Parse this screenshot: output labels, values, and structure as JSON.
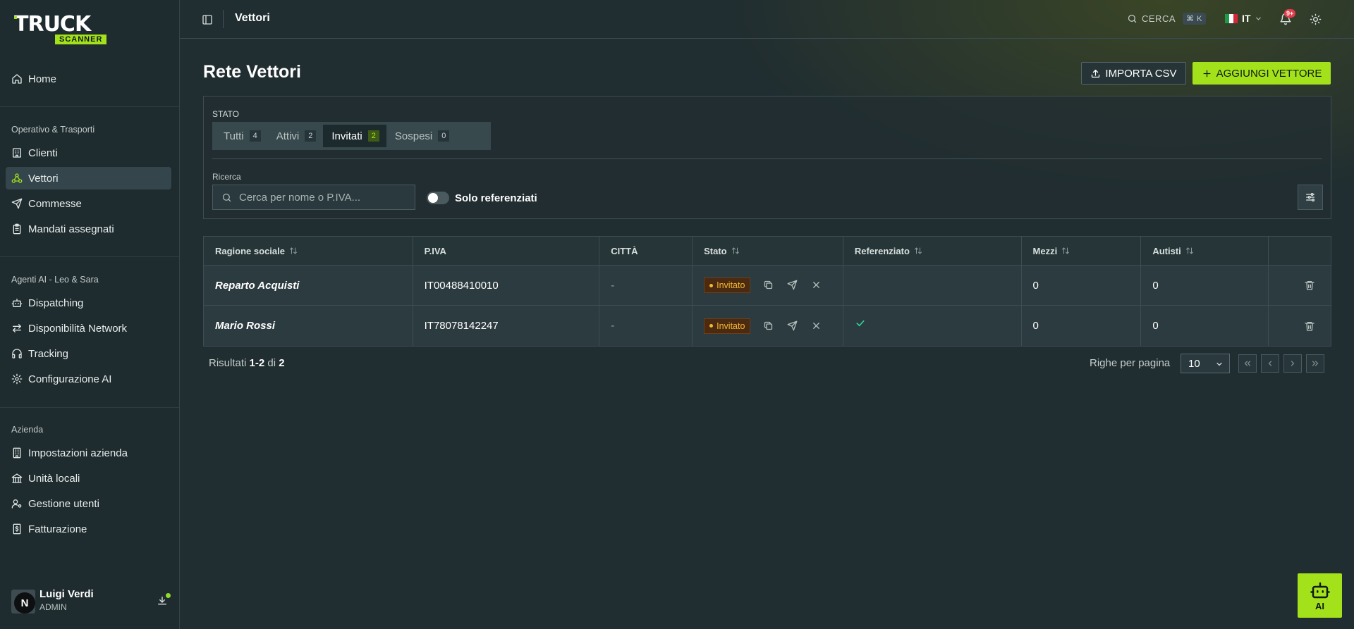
{
  "brand": {
    "line1": "TRUCK",
    "line2": "SCANNER",
    "accent": "#a3e21b"
  },
  "sidebar": {
    "home": "Home",
    "sections": [
      {
        "title": "Operativo & Trasporti",
        "items": [
          "Clienti",
          "Vettori",
          "Commesse",
          "Mandati assegnati"
        ]
      },
      {
        "title": "Agenti AI - Leo & Sara",
        "items": [
          "Dispatching",
          "Disponibilità Network",
          "Tracking",
          "Configurazione AI"
        ]
      },
      {
        "title": "Azienda",
        "items": [
          "Impostazioni azienda",
          "Unità locali",
          "Gestione utenti",
          "Fatturazione"
        ]
      }
    ],
    "active_item": "Vettori",
    "user": {
      "initial": "N",
      "name": "Luigi Verdi",
      "role": "ADMIN"
    }
  },
  "header": {
    "title": "Vettori",
    "search_label": "CERCA",
    "shortcut": "⌘ K",
    "language": "IT",
    "notifications": "9+"
  },
  "main": {
    "title": "Rete Vettori",
    "import_label": "IMPORTA CSV",
    "add_label": "AGGIUNGI VETTORE",
    "filters": {
      "status_label": "STATO",
      "tabs": [
        {
          "label": "Tutti",
          "count": "4"
        },
        {
          "label": "Attivi",
          "count": "2"
        },
        {
          "label": "Invitati",
          "count": "2"
        },
        {
          "label": "Sospesi",
          "count": "0"
        }
      ],
      "active_tab": "Invitati",
      "search_label": "Ricerca",
      "search_placeholder": "Cerca per nome o P.IVA...",
      "search_value": "",
      "toggle_label": "Solo referenziati",
      "toggle_on": false
    },
    "table": {
      "columns": [
        "Ragione sociale",
        "P.IVA",
        "CITTÀ",
        "Stato",
        "Referenziato",
        "Mezzi",
        "Autisti"
      ],
      "rows": [
        {
          "company": "Reparto Acquisti",
          "vat": "IT00488410010",
          "city": "-",
          "status": "Invitato",
          "referenced": false,
          "vehicles": "0",
          "drivers": "0"
        },
        {
          "company": "Mario Rossi",
          "vat": "IT78078142247",
          "city": "-",
          "status": "Invitato",
          "referenced": true,
          "vehicles": "0",
          "drivers": "0"
        }
      ]
    },
    "pagination": {
      "results_prefix": "Risultati",
      "range": "1-2",
      "of": "di",
      "total": "2",
      "rows_per_page_label": "Righe per pagina",
      "rows_per_page": "10"
    },
    "ai_button": "AI"
  }
}
